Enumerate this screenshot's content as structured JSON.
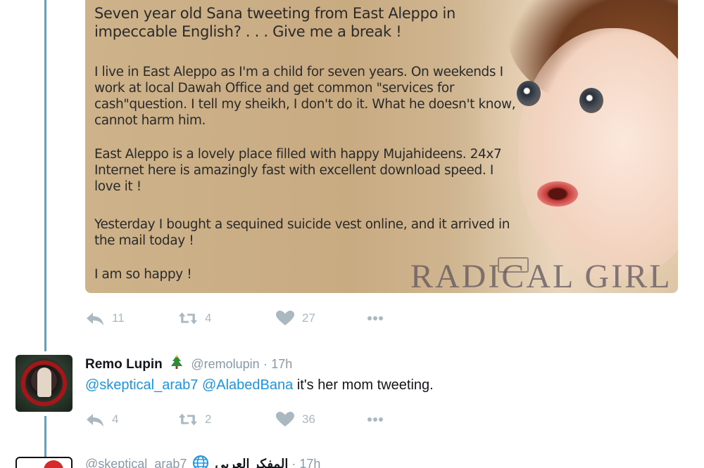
{
  "meme": {
    "headline": "Seven year old Sana tweeting from East Aleppo in impeccable English? . . . Give me a break !",
    "paragraph_1": "I live in East Aleppo as I'm a child for seven years. On weekends I work at local Dawah Office and get common \"services for cash\"question. I tell my sheikh, I don't do it. What he doesn't know, cannot harm him.",
    "paragraph_2": "East Aleppo is a lovely place filled with happy Mujahideens. 24x7 Internet here is amazingly fast with excellent download speed. I love it !",
    "paragraph_3": "Yesterday I bought a sequined suicide vest online, and it arrived in the mail today !",
    "paragraph_4": "I am so happy !",
    "watermark": "RADICAL GIRL"
  },
  "tweet_1_actions": {
    "replies": "11",
    "retweets": "4",
    "likes": "27"
  },
  "reply_tweet": {
    "display_name": "Remo Lupin",
    "handle": "@remolupin",
    "separator": "·",
    "time": "17h",
    "mention_1": "@skeptical_arab7",
    "mention_2": "@AlabedBana",
    "text": "it's her mom tweeting.",
    "actions": {
      "replies": "4",
      "retweets": "2",
      "likes": "36"
    }
  },
  "next_tweet": {
    "handle": "@skeptical_arab7",
    "display_name": "المفكر العربي",
    "separator": "·",
    "time": "17h"
  },
  "colors": {
    "thread_line": "#4aa8d8",
    "link": "#1b95e0",
    "action_icon": "#aab8c2",
    "muted_text": "#8899a6"
  },
  "icons": [
    "reply-icon",
    "retweet-icon",
    "like-icon",
    "more-icon",
    "christmas-tree-icon",
    "globe-icon"
  ]
}
